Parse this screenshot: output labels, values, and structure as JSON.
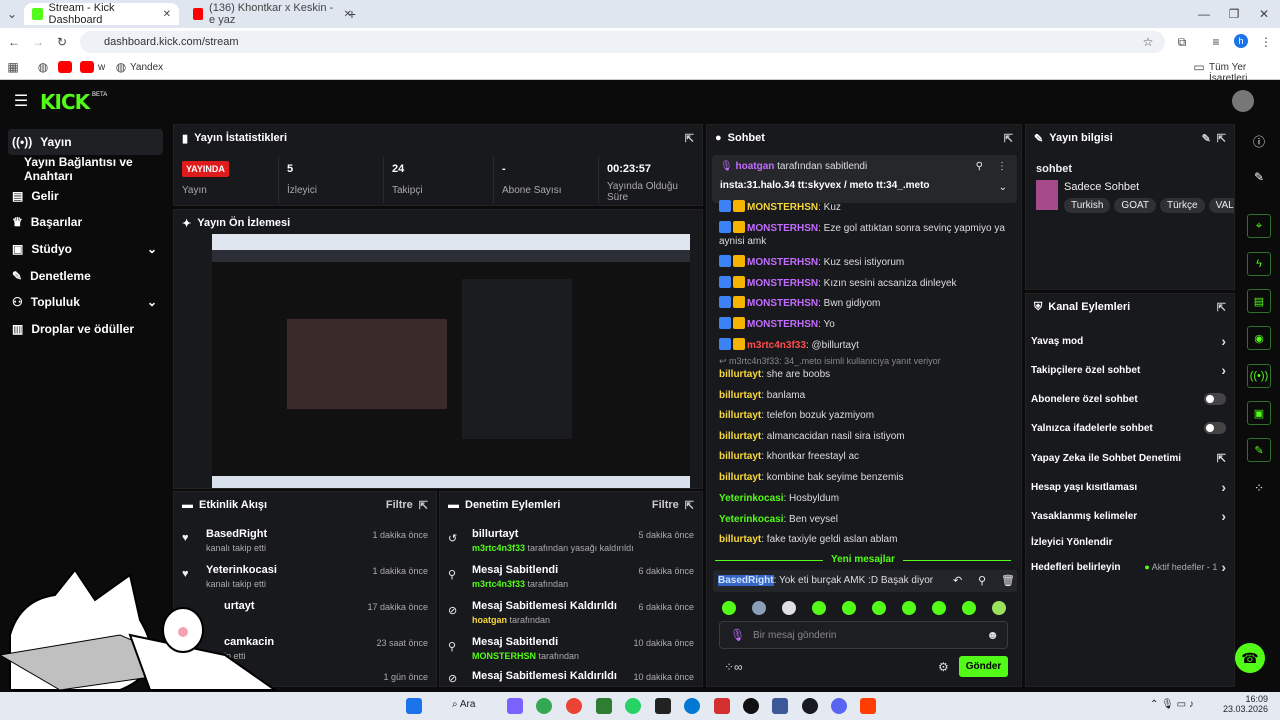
{
  "browser": {
    "tabs": [
      {
        "title": "Stream - Kick Dashboard"
      },
      {
        "title": "(136) Khontkar x Keskin - e yaz"
      }
    ],
    "url": "dashboard.kick.com/stream",
    "bookmarks": [
      "w",
      "Yandex"
    ],
    "bookmarks_right": "Tüm Yer İşaretleri",
    "profile_initial": "h"
  },
  "sidebar": {
    "items": [
      {
        "label": "Yayın"
      },
      {
        "label": "Yayın Bağlantısı ve Anahtarı"
      },
      {
        "label": "Gelir"
      },
      {
        "label": "Başarılar"
      },
      {
        "label": "Stüdyo"
      },
      {
        "label": "Denetleme"
      },
      {
        "label": "Topluluk"
      },
      {
        "label": "Droplar ve ödüller"
      }
    ]
  },
  "stats": {
    "title": "Yayın İstatistikleri",
    "live_badge": "YAYINDA",
    "items": [
      {
        "value": "",
        "label": "Yayın"
      },
      {
        "value": "5",
        "label": "İzleyici"
      },
      {
        "value": "24",
        "label": "Takipçi"
      },
      {
        "value": "-",
        "label": "Abone Sayısı"
      },
      {
        "value": "00:23:57",
        "label": "Yayında Olduğu Süre"
      }
    ]
  },
  "preview": {
    "title": "Yayın Ön İzlemesi"
  },
  "activity": {
    "title": "Etkinlik Akışı",
    "filter": "Filtre",
    "rows": [
      {
        "name": "BasedRight",
        "sub": "kanalı takip etti",
        "time": "1 dakika önce"
      },
      {
        "name": "Yeterinkocasi",
        "sub": "kanalı takip etti",
        "time": "1 dakika önce"
      },
      {
        "name": "urtayt",
        "sub": "",
        "time": "17 dakika önce"
      },
      {
        "name": "camkacin",
        "sub": "ip etti",
        "time": "23 saat önce"
      },
      {
        "name": "",
        "sub": "",
        "time": "1 gün önce"
      }
    ]
  },
  "moderation": {
    "title": "Denetim Eylemleri",
    "filter": "Filtre",
    "rows": [
      {
        "name": "billurtayt",
        "user": "m3rtc4n3f33",
        "sub": "tarafından yasağı kaldırıldı",
        "time": "5 dakika önce"
      },
      {
        "name": "Mesaj Sabitlendi",
        "user": "m3rtc4n3f33",
        "sub": "tarafından",
        "time": "6 dakika önce"
      },
      {
        "name": "Mesaj Sabitlemesi Kaldırıldı",
        "user": "hoatgan",
        "sub": "tarafından",
        "time": "6 dakika önce"
      },
      {
        "name": "Mesaj Sabitlendi",
        "user": "MONSTERHSN",
        "sub": "tarafından",
        "time": "10 dakika önce"
      },
      {
        "name": "Mesaj Sabitlemesi Kaldırıldı",
        "user": "",
        "sub": "",
        "time": "10 dakika önce"
      }
    ]
  },
  "chat": {
    "title": "Sohbet",
    "pinned_by": "hoatgan",
    "pinned_suffix": "tarafından sabitlendi",
    "pinned_text": "insta:31.halo.34 tt:skyvex / meto tt:34_.meto",
    "messages": [
      {
        "user": "MONSTERHSN",
        "text": ": Kuz"
      },
      {
        "user": "MONSTERHSN",
        "text": ": Eze gol attıktan sonra sevinç yapmiyo ya"
      },
      {
        "user": "",
        "text": "aynisi amk"
      },
      {
        "user": "MONSTERHSN",
        "text": ": Kuz sesi istiyorum"
      },
      {
        "user": "MONSTERHSN",
        "text": ": Kızın sesini acsaniza dinleyek"
      },
      {
        "user": "MONSTERHSN",
        "text": ": Bwn gidiyom"
      },
      {
        "user": "MONSTERHSN",
        "text": ": Yo"
      },
      {
        "user": "m3rtc4n3f33",
        "text": ": @billurtayt"
      },
      {
        "user": "",
        "text": "m3rtc4n3f33: 34_.meto isimli kullanıcıya yanıt veriyor"
      },
      {
        "user": "billurtayt",
        "text": ": she are boobs"
      },
      {
        "user": "billurtayt",
        "text": ": banlama"
      },
      {
        "user": "billurtayt",
        "text": ": telefon bozuk yazmiyom"
      },
      {
        "user": "billurtayt",
        "text": ": almancacidan nasil sira istiyom"
      },
      {
        "user": "billurtayt",
        "text": ": khontkar freestayl ac"
      },
      {
        "user": "billurtayt",
        "text": ": kombine bak seyime benzemis"
      },
      {
        "user": "Yeterinkocasi",
        "text": ": Hosbyldum"
      },
      {
        "user": "Yeterinkocasi",
        "text": ": Ben veysel"
      },
      {
        "user": "billurtayt",
        "text": ": fake taxiyle geldi aslan ablam"
      }
    ],
    "new_messages": "Yeni mesajlar",
    "hover_user": "BasedRight",
    "hover_text": ": Yok eti burçak AMK :D Başak diyor",
    "input_placeholder": "Bir mesaj gönderin",
    "send_label": "Gönder"
  },
  "stream_info": {
    "title": "Yayın bilgisi",
    "category_label": "sohbet",
    "category_name": "Sadece Sohbet",
    "tags": [
      "Turkish",
      "GOAT",
      "Türkçe",
      "VALO"
    ]
  },
  "channel_actions": {
    "title": "Kanal Eylemleri",
    "items": [
      {
        "label": "Yavaş mod",
        "control": "chevron"
      },
      {
        "label": "Takipçilere özel sohbet",
        "control": "chevron"
      },
      {
        "label": "Abonelere özel sohbet",
        "control": "toggle"
      },
      {
        "label": "Yalnızca ifadelerle sohbet",
        "control": "toggle"
      },
      {
        "label": "Yapay Zeka ile Sohbet Denetimi",
        "control": "link"
      },
      {
        "label": "Hesap yaşı kısıtlaması",
        "control": "chevron"
      },
      {
        "label": "Yasaklanmış kelimeler",
        "control": "chevron"
      },
      {
        "label": "İzleyici Yönlendir",
        "control": "none"
      },
      {
        "label": "Hedefleri belirleyin",
        "control": "chevron"
      }
    ],
    "goals_status": "Aktif hedefler - 1"
  },
  "taskbar": {
    "search": "Ara",
    "time": "16:09",
    "date": "23.03.2026"
  },
  "colors": {
    "accent": "#53fc18",
    "live": "#e01b1b",
    "panel": "#18191c"
  }
}
